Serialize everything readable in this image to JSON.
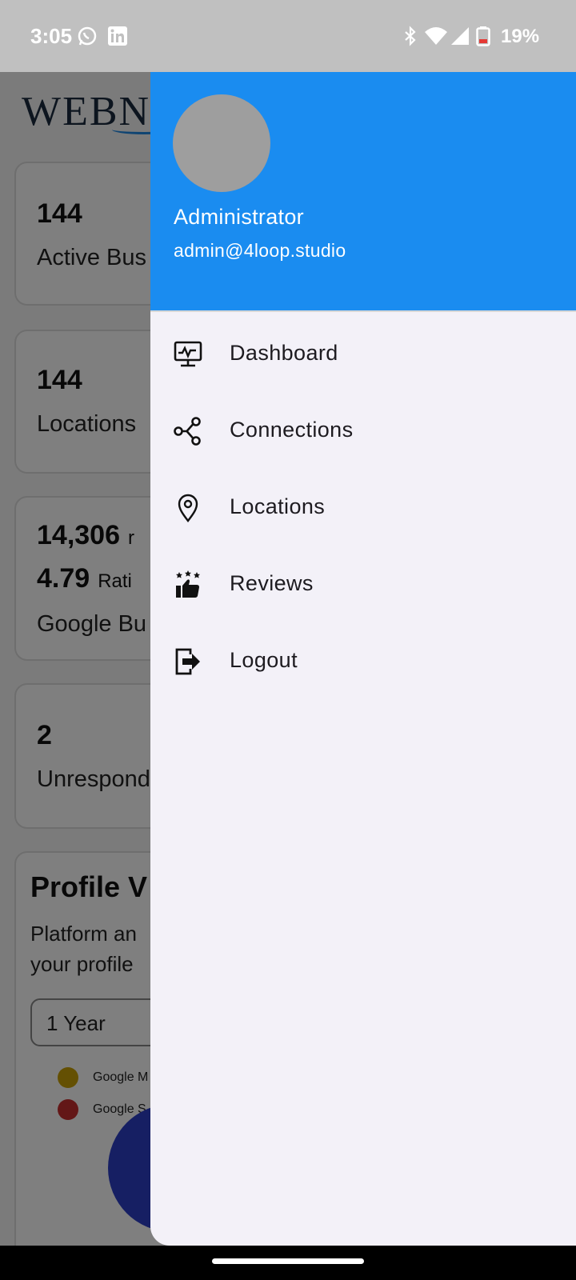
{
  "status_bar": {
    "time": "3:05",
    "battery_percent": "19%"
  },
  "background_app": {
    "logo_text": "WEBN",
    "cards": [
      {
        "value": "144",
        "label": "Active Bus"
      },
      {
        "value": "144",
        "label": "Locations"
      },
      {
        "value": "14,306",
        "value_suffix": "r",
        "rating": "4.79",
        "rating_label": "Rati",
        "label": "Google Bu"
      },
      {
        "value": "2",
        "label": "Unrespond"
      }
    ],
    "profile_card": {
      "title": "Profile V",
      "description": "Platform an\nyour profile",
      "period_select": "1 Year",
      "legend": [
        {
          "label": "Google M",
          "color": "#c9a106"
        },
        {
          "label": "Google S",
          "color": "#c62f2f"
        }
      ]
    }
  },
  "drawer": {
    "header_color": "#1a8cf0",
    "user_name": "Administrator",
    "user_email": "admin@4loop.studio",
    "menu": [
      {
        "label": "Dashboard",
        "icon": "dashboard-monitor-icon"
      },
      {
        "label": "Connections",
        "icon": "share-nodes-icon"
      },
      {
        "label": "Locations",
        "icon": "map-pin-icon"
      },
      {
        "label": "Reviews",
        "icon": "thumbs-up-stars-icon"
      },
      {
        "label": "Logout",
        "icon": "logout-icon"
      }
    ]
  }
}
